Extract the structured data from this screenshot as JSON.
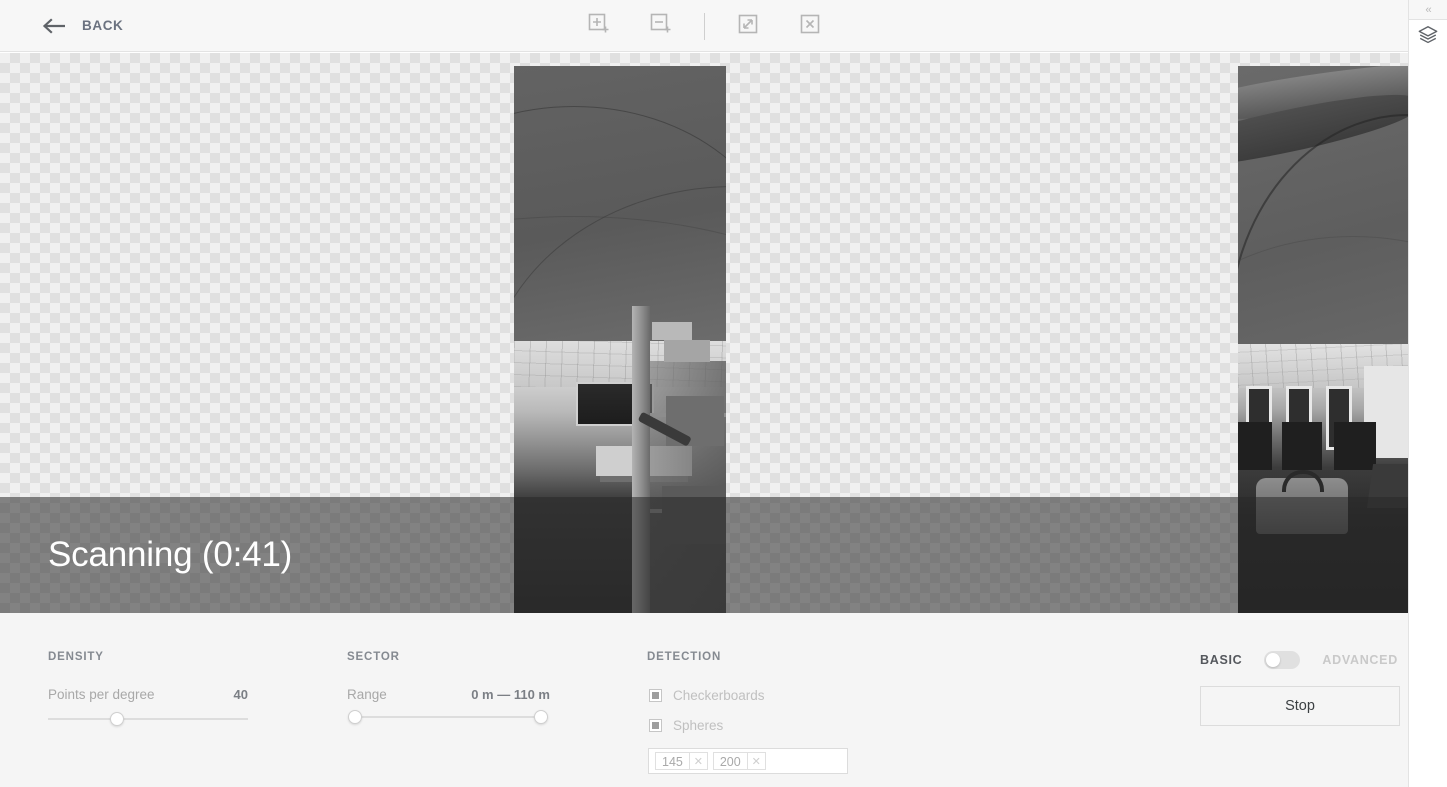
{
  "topbar": {
    "back_label": "BACK",
    "back_icon": "arrow-left-icon",
    "tools": [
      {
        "name": "add-selection-icon",
        "icon": "rectangle-plus"
      },
      {
        "name": "subtract-selection-icon",
        "icon": "rectangle-minus"
      },
      {
        "name": "fit-to-screen-icon",
        "icon": "expand-diagonal"
      },
      {
        "name": "clear-selection-icon",
        "icon": "rectangle-x"
      }
    ]
  },
  "right_rail": {
    "collapse_icon": "chevrons-left-icon",
    "layers_icon": "layers-icon"
  },
  "viewport": {
    "status_text": "Scanning (0:41)",
    "scan_alt_1": "panorama-scan-strip-ceiling-office",
    "scan_alt_2": "panorama-scan-strip-ceiling-workstations"
  },
  "controls": {
    "density": {
      "title": "DENSITY",
      "label": "Points per degree",
      "value": "40"
    },
    "sector": {
      "title": "SECTOR",
      "label": "Range",
      "value": "0 m — 110 m"
    },
    "detection": {
      "title": "DETECTION",
      "checkboxes": [
        {
          "label": "Checkerboards"
        },
        {
          "label": "Spheres"
        }
      ],
      "chips": [
        {
          "value": "145",
          "remove_icon": "close-icon"
        },
        {
          "value": "200",
          "remove_icon": "close-icon"
        }
      ]
    },
    "mode": {
      "basic_label": "BASIC",
      "advanced_label": "ADVANCED",
      "selected": "BASIC"
    },
    "stop_label": "Stop"
  },
  "colors": {
    "panel_bg": "#f5f5f5",
    "topbar_bg": "#f7f7f7",
    "muted_text": "#a8a8a8",
    "section_title": "#858a91",
    "status_overlay": "rgba(40,40,40,0.55)"
  }
}
